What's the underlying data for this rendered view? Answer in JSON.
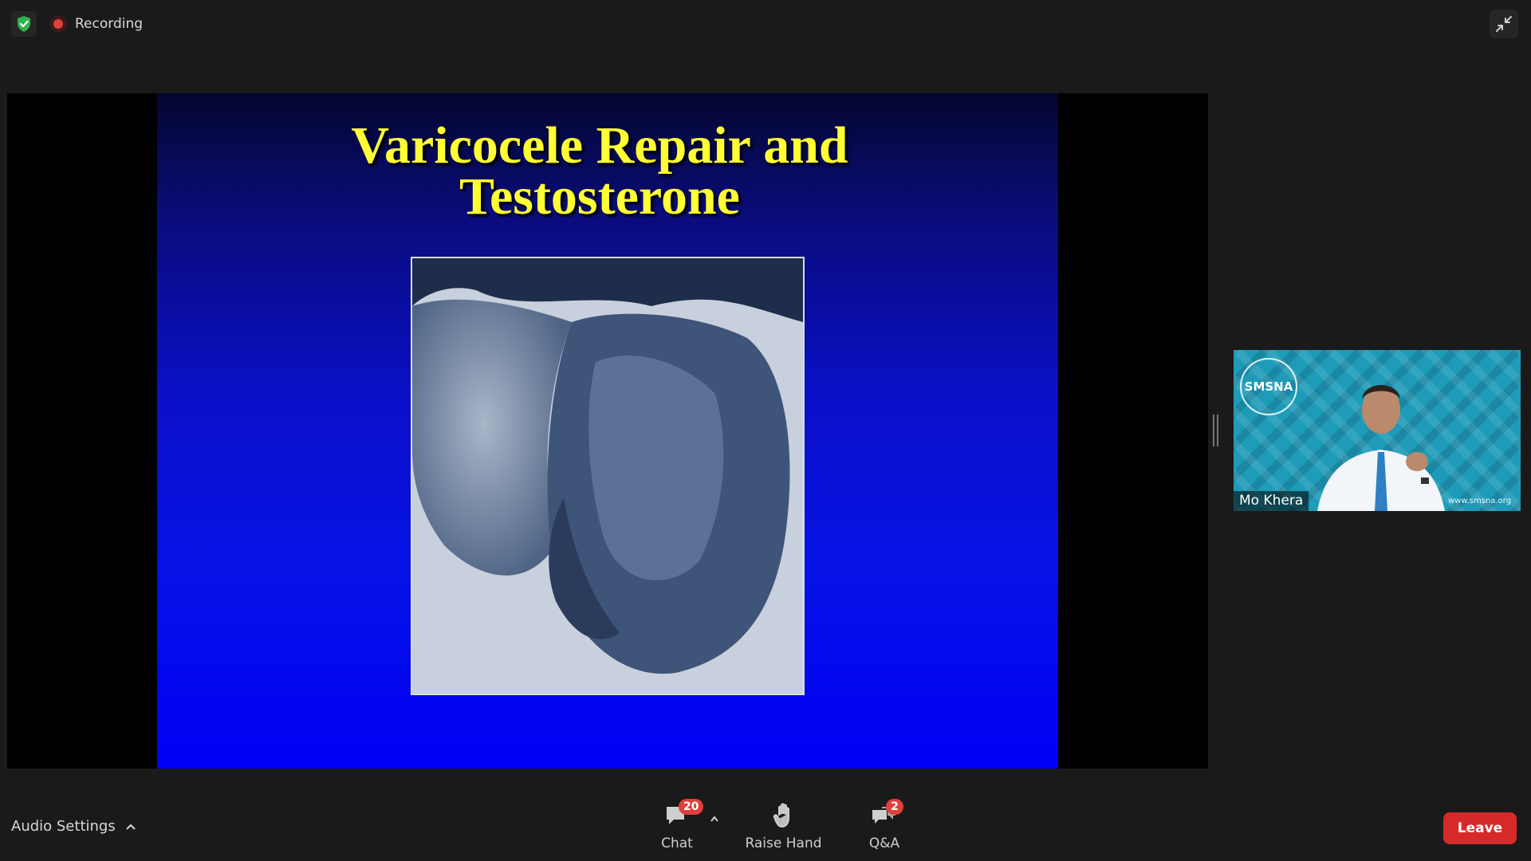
{
  "topbar": {
    "recording_label": "Recording"
  },
  "slide": {
    "title": "Varicocele Repair and\nTestosterone"
  },
  "participant": {
    "name": "Mo Khera",
    "logo_text": "SMSNA",
    "website": "www.smsna.org"
  },
  "toolbar": {
    "audio_settings_label": "Audio Settings",
    "chat_label": "Chat",
    "chat_badge": "20",
    "raise_hand_label": "Raise Hand",
    "qa_label": "Q&A",
    "qa_badge": "2",
    "leave_label": "Leave"
  },
  "colors": {
    "leave": "#d62a2a",
    "badge": "#e0403a",
    "slide_title": "#ffff33",
    "slide_bg": "#0612e6",
    "security_shield": "#2fb34a"
  }
}
